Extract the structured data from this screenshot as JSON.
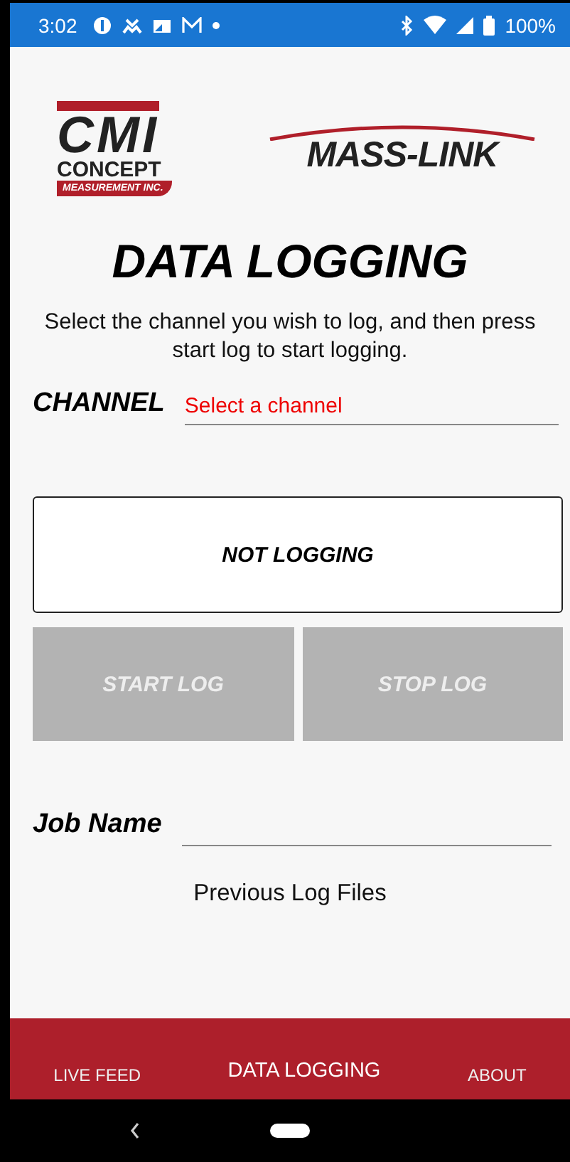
{
  "status_bar": {
    "time": "3:02",
    "battery": "100%"
  },
  "logos": {
    "cmi": {
      "mark": "CMI",
      "name": "CONCEPT",
      "tagline": "MEASUREMENT INC."
    },
    "masslink": {
      "name": "MASS-LINK"
    }
  },
  "title": "DATA LOGGING",
  "instructions": "Select the channel you wish to log, and then press start log to start logging.",
  "channel": {
    "label": "CHANNEL",
    "placeholder": "Select a channel"
  },
  "log_status": "NOT LOGGING",
  "buttons": [
    {
      "label": "START LOG",
      "disabled": true
    },
    {
      "label": "STOP LOG",
      "disabled": true
    }
  ],
  "job_name": {
    "label": "Job Name"
  },
  "previous_logs": "Previous Log Files",
  "tabs": [
    {
      "label": "LIVE FEED",
      "selected": false
    },
    {
      "label": "DATA LOGGING",
      "selected": true
    },
    {
      "label": "ABOUT",
      "selected": false
    }
  ]
}
